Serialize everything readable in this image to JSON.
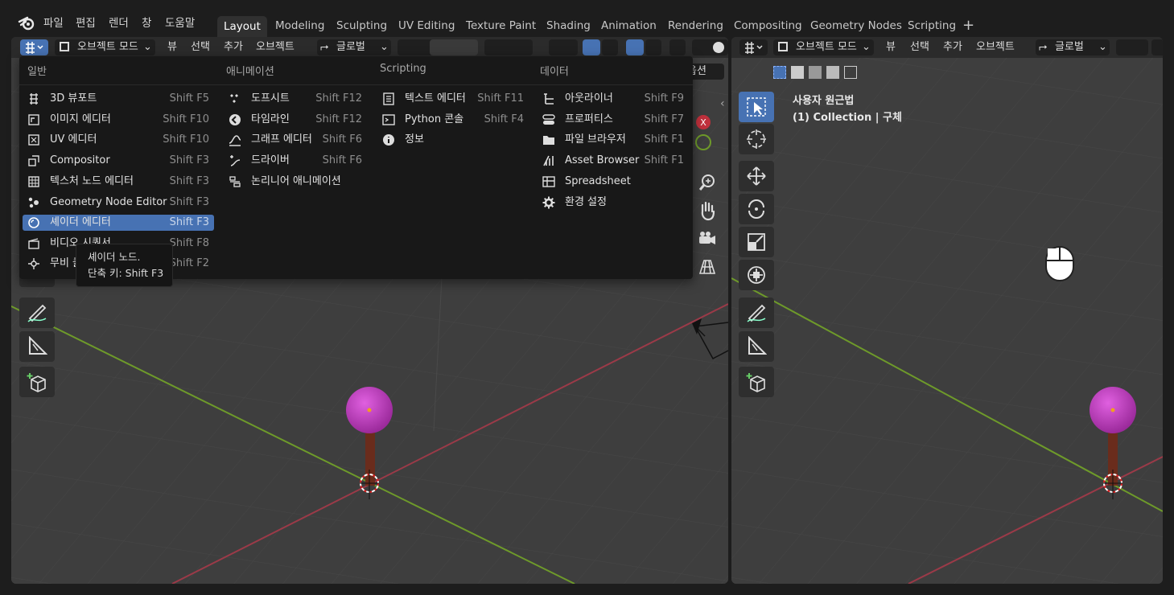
{
  "menubar": {
    "items": [
      "파일",
      "편집",
      "렌더",
      "창",
      "도움말"
    ]
  },
  "workspaces": {
    "tabs": [
      "Layout",
      "Modeling",
      "Sculpting",
      "UV Editing",
      "Texture Paint",
      "Shading",
      "Animation",
      "Rendering",
      "Compositing",
      "Geometry Nodes",
      "Scripting"
    ],
    "active": "Layout",
    "add_label": "+"
  },
  "left_header": {
    "mode": "오브젝트 모드",
    "view": "뷰",
    "select": "선택",
    "add": "추가",
    "object": "오브젝트",
    "orientation": "글로벌",
    "options": "옵션"
  },
  "right_header": {
    "mode": "오브젝트 모드",
    "view": "뷰",
    "select": "선택",
    "add": "추가",
    "object": "오브젝트",
    "orientation": "글로벌"
  },
  "viewport_info": {
    "view_name": "사용자 원근법",
    "collection": "(1) Collection | 구체"
  },
  "editor_menu": {
    "columns": [
      {
        "heading": "일반",
        "items": [
          {
            "label": "3D 뷰포트",
            "shortcut": "Shift F5",
            "icon": "3d-viewport-icon"
          },
          {
            "label": "이미지 에디터",
            "shortcut": "Shift F10",
            "icon": "image-editor-icon"
          },
          {
            "label": "UV 에디터",
            "shortcut": "Shift F10",
            "icon": "uv-editor-icon"
          },
          {
            "label": "Compositor",
            "shortcut": "Shift F3",
            "icon": "compositor-icon"
          },
          {
            "label": "텍스처 노드 에디터",
            "shortcut": "Shift F3",
            "icon": "texture-node-icon"
          },
          {
            "label": "Geometry Node Editor",
            "shortcut": "Shift F3",
            "icon": "geometry-node-icon"
          },
          {
            "label": "셰이더 에디터",
            "shortcut": "Shift F3",
            "icon": "shader-editor-icon",
            "highlighted": true
          },
          {
            "label": "비디오 시퀀서",
            "shortcut": "Shift F8",
            "icon": "video-sequencer-icon"
          },
          {
            "label": "무비 클립 에디터",
            "shortcut": "Shift F2",
            "icon": "movie-clip-icon"
          }
        ]
      },
      {
        "heading": "애니메이션",
        "items": [
          {
            "label": "도프시트",
            "shortcut": "Shift F12",
            "icon": "dopesheet-icon"
          },
          {
            "label": "타임라인",
            "shortcut": "Shift F12",
            "icon": "timeline-icon"
          },
          {
            "label": "그래프 에디터",
            "shortcut": "Shift F6",
            "icon": "graph-editor-icon"
          },
          {
            "label": "드라이버",
            "shortcut": "Shift F6",
            "icon": "drivers-icon"
          },
          {
            "label": "논리니어 애니메이션",
            "shortcut": "",
            "icon": "nla-icon"
          }
        ]
      },
      {
        "heading": "Scripting",
        "items": [
          {
            "label": "텍스트 에디터",
            "shortcut": "Shift F11",
            "icon": "text-editor-icon"
          },
          {
            "label": "Python 콘솔",
            "shortcut": "Shift F4",
            "icon": "python-console-icon"
          },
          {
            "label": "정보",
            "shortcut": "",
            "icon": "info-icon"
          }
        ]
      },
      {
        "heading": "데이터",
        "items": [
          {
            "label": "아웃라이너",
            "shortcut": "Shift F9",
            "icon": "outliner-icon"
          },
          {
            "label": "프로퍼티스",
            "shortcut": "Shift F7",
            "icon": "properties-icon"
          },
          {
            "label": "파일 브라우저",
            "shortcut": "Shift F1",
            "icon": "file-browser-icon"
          },
          {
            "label": "Asset Browser",
            "shortcut": "Shift F1",
            "icon": "asset-browser-icon"
          },
          {
            "label": "Spreadsheet",
            "shortcut": "",
            "icon": "spreadsheet-icon"
          },
          {
            "label": "환경 설정",
            "shortcut": "",
            "icon": "preferences-icon"
          }
        ]
      }
    ]
  },
  "tooltip": {
    "title": "셰이더 노드.",
    "shortcut": "단축 키: Shift F3"
  },
  "colors": {
    "accent": "#4772b3",
    "sphere": "#c33dc3",
    "stick": "#6a2c1c",
    "x_axis": "#9b3a48",
    "y_axis": "#6e9a2a"
  }
}
